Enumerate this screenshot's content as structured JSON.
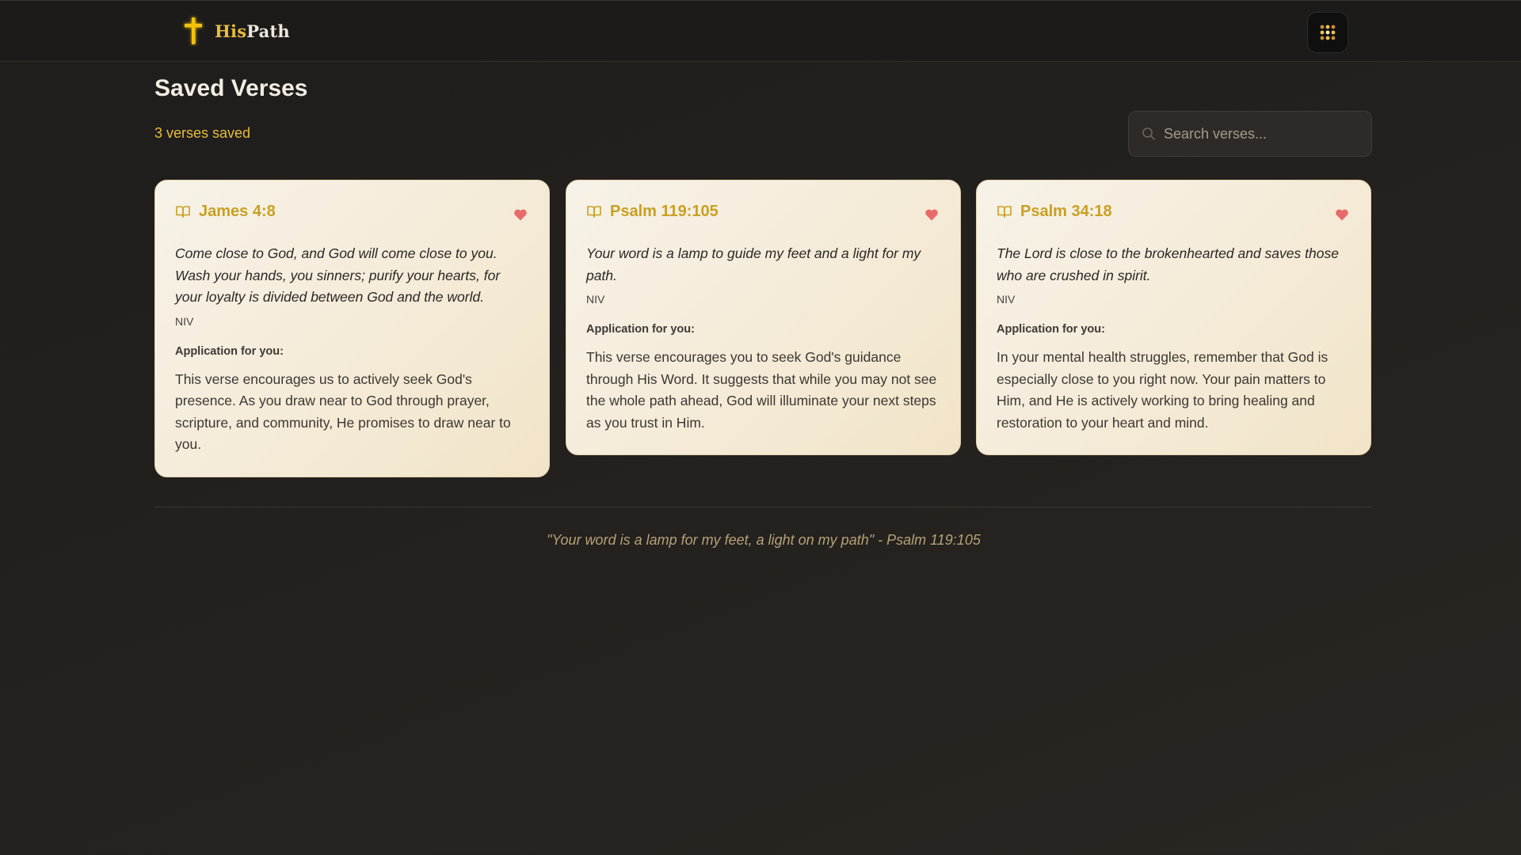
{
  "app": {
    "brand_part1": "His",
    "brand_part2": "Path",
    "logo_icon": "cross-icon",
    "menu_icon": "dots-grid-icon"
  },
  "page": {
    "title": "Saved Verses",
    "count_label": "3 verses saved"
  },
  "search": {
    "placeholder": "Search verses...",
    "value": "",
    "icon": "search-icon"
  },
  "verses": [
    {
      "reference": "James 4:8",
      "text": "Come close to God, and God will come close to you. Wash your hands, you sinners; purify your hearts, for your loyalty is divided between God and the world.",
      "translation": "NIV",
      "application_label": "Application for you:",
      "application": "This verse encourages us to actively seek God's presence. As you draw near to God through prayer, scripture, and community, He promises to draw near to you."
    },
    {
      "reference": "Psalm 119:105",
      "text": "Your word is a lamp to guide my feet and a light for my path.",
      "translation": "NIV",
      "application_label": "Application for you:",
      "application": "This verse encourages you to seek God's guidance through His Word. It suggests that while you may not see the whole path ahead, God will illuminate your next steps as you trust in Him."
    },
    {
      "reference": "Psalm 34:18",
      "text": "The Lord is close to the brokenhearted and saves those who are crushed in spirit.",
      "translation": "NIV",
      "application_label": "Application for you:",
      "application": "In your mental health struggles, remember that God is especially close to you right now. Your pain matters to Him, and He is actively working to bring healing and restoration to your heart and mind."
    }
  ],
  "footer": {
    "quote": "\"Your word is a lamp for my feet, a light on my path\" - Psalm 119:105"
  },
  "colors": {
    "accent_gold": "#e7bd3a",
    "heart": "#e86a6a",
    "card_bg": "#f5ecd9",
    "page_bg": "#211f1c"
  }
}
